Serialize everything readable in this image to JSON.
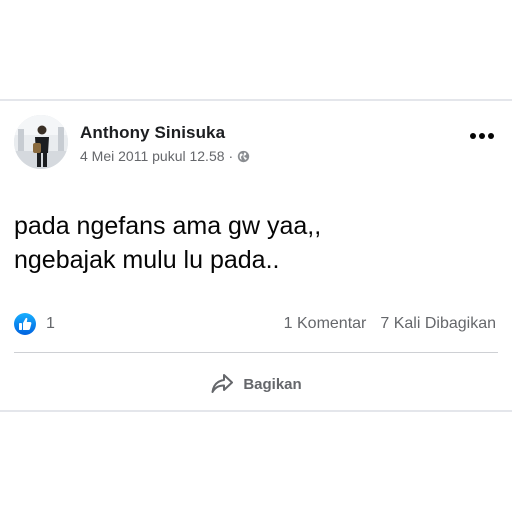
{
  "post": {
    "author_name": "Anthony Sinisuka",
    "timestamp": "4 Mei 2011 pukul 12.58",
    "separator": "·",
    "privacy_icon": "globe-icon",
    "more_icon": "more-options-icon",
    "content_lines": [
      "pada ngefans ama gw yaa,,",
      "ngebajak mulu lu pada.."
    ]
  },
  "stats": {
    "reaction_icon": "like-reaction-icon",
    "reaction_count": "1",
    "comments": "1 Komentar",
    "shares": "7 Kali Dibagikan"
  },
  "actions": {
    "share_label": "Bagikan",
    "share_icon": "share-icon"
  },
  "colors": {
    "like_blue": "#1877f2",
    "text_primary": "#050505",
    "text_secondary": "#65676b",
    "divider": "#ced0d4"
  }
}
